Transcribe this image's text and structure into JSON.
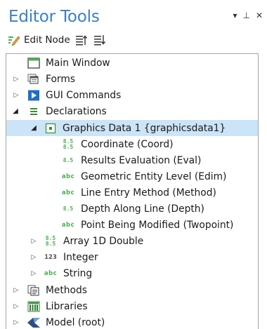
{
  "panel": {
    "title": "Editor Tools",
    "controls": [
      "▾",
      "⊥",
      "✕"
    ]
  },
  "toolbar": {
    "edit_node_label": "Edit Node"
  },
  "tree": {
    "main_window": "Main Window",
    "forms": "Forms",
    "gui_commands": "GUI Commands",
    "declarations": "Declarations",
    "graphics_data": "Graphics Data 1 {graphicsdata1}",
    "children": [
      {
        "label": "Coordinate (Coord)",
        "icon": "8.5 stacked"
      },
      {
        "label": "Results Evaluation (Eval)",
        "icon": "8.5"
      },
      {
        "label": "Geometric Entity Level (Edim)",
        "icon": "abc"
      },
      {
        "label": "Line Entry Method (Method)",
        "icon": "abc"
      },
      {
        "label": "Depth Along Line (Depth)",
        "icon": "8.5"
      },
      {
        "label": "Point Being Modified (Twopoint)",
        "icon": "abc"
      }
    ],
    "array_1d_double": "Array 1D Double",
    "integer": "Integer",
    "string": "String",
    "methods": "Methods",
    "libraries": "Libraries",
    "model_root": "Model (root)",
    "icon_text": {
      "num": "8.5",
      "abc": "abc",
      "int": "123"
    }
  }
}
